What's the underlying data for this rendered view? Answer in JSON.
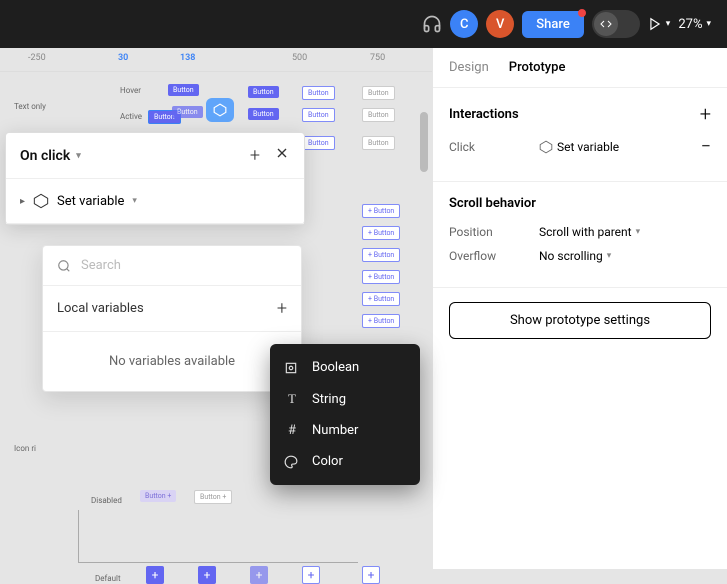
{
  "topbar": {
    "avatar_c": "C",
    "avatar_v": "V",
    "share": "Share",
    "zoom": "27%"
  },
  "ruler": {
    "m250": "-250",
    "m30": "30",
    "m138": "138",
    "m500": "500",
    "m750": "750"
  },
  "canvas": {
    "text_only": "Text only",
    "hover": "Hover",
    "active": "Active",
    "icon_right": "Icon ri",
    "disabled": "Disabled",
    "default": "Default",
    "button": "Button",
    "button_plus": "+ Button"
  },
  "right": {
    "tab_design": "Design",
    "tab_prototype": "Prototype",
    "interactions": "Interactions",
    "click": "Click",
    "set_variable": "Set variable",
    "scroll_behavior": "Scroll behavior",
    "position": "Position",
    "position_value": "Scroll with parent",
    "overflow": "Overflow",
    "overflow_value": "No scrolling",
    "show_settings": "Show prototype settings"
  },
  "popup": {
    "title": "On click",
    "set_variable": "Set variable"
  },
  "search": {
    "placeholder": "Search",
    "local_vars": "Local variables",
    "no_vars": "No variables available"
  },
  "menu": {
    "boolean": "Boolean",
    "string": "String",
    "number": "Number",
    "color": "Color"
  }
}
